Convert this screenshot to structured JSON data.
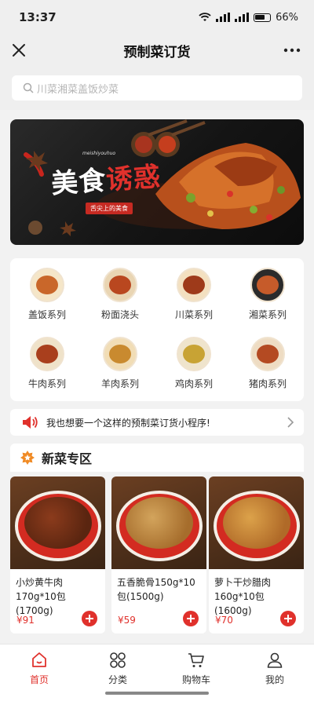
{
  "status_bar": {
    "time": "13:37",
    "battery": "66%"
  },
  "nav": {
    "title": "预制菜订货",
    "close_icon": "close-icon",
    "more_icon": "more-icon"
  },
  "search": {
    "placeholder": "川菜湘菜盖饭炒菜"
  },
  "banner": {
    "title_main": "美食",
    "title_accent": "诱惑",
    "pinyin": "meishiyouhuo",
    "subtitle": "舌尖上的美食"
  },
  "categories": [
    {
      "label": "盖饭系列"
    },
    {
      "label": "粉面浇头"
    },
    {
      "label": "川菜系列"
    },
    {
      "label": "湘菜系列"
    },
    {
      "label": "牛肉系列"
    },
    {
      "label": "羊肉系列"
    },
    {
      "label": "鸡肉系列"
    },
    {
      "label": "猪肉系列"
    }
  ],
  "notice": {
    "text": "我也想要一个这样的预制菜订货小程序!"
  },
  "section": {
    "title": "新菜专区"
  },
  "products": [
    {
      "name": "小炒黄牛肉170g*10包(1700g)",
      "price": "¥91"
    },
    {
      "name": "五香脆骨150g*10包(1500g)",
      "price": "¥59"
    },
    {
      "name": "萝卜干炒腊肉160g*10包(1600g)",
      "price": "¥70"
    }
  ],
  "tabs": [
    {
      "label": "首页",
      "active": true
    },
    {
      "label": "分类",
      "active": false
    },
    {
      "label": "购物车",
      "active": false
    },
    {
      "label": "我的",
      "active": false
    }
  ],
  "colors": {
    "accent": "#e0312c",
    "background": "#f2f2f2"
  }
}
